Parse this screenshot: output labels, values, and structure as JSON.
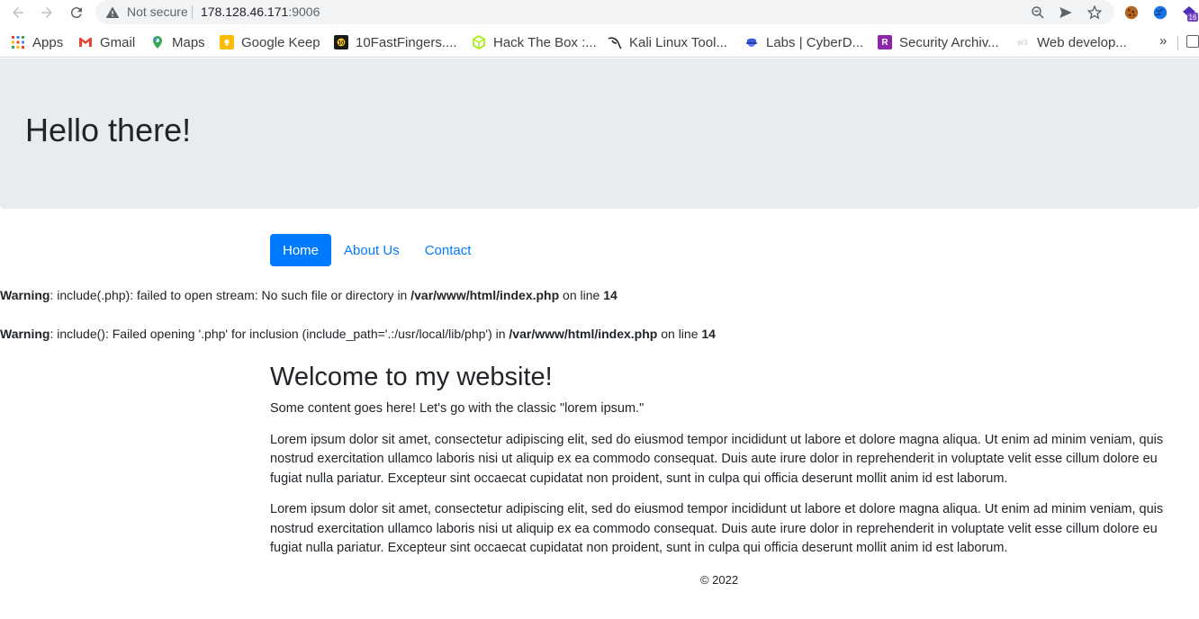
{
  "browser": {
    "not_secure": "Not secure",
    "url_host": "178.128.46.171",
    "url_port": ":9006"
  },
  "bookmarks": [
    {
      "label": "Apps",
      "icon": "apps-grid-icon"
    },
    {
      "label": "Gmail",
      "icon": "gmail-icon"
    },
    {
      "label": "Maps",
      "icon": "maps-icon"
    },
    {
      "label": "Google Keep",
      "icon": "keep-icon"
    },
    {
      "label": "10FastFingers....",
      "icon": "10fastfingers-icon"
    },
    {
      "label": "Hack The Box :...",
      "icon": "hackthebox-icon"
    },
    {
      "label": "Kali Linux Tool...",
      "icon": "kali-icon"
    },
    {
      "label": "Labs | CyberD...",
      "icon": "cyberdefenders-icon"
    },
    {
      "label": "Security Archiv...",
      "icon": "security-archive-icon"
    },
    {
      "label": "Web develop...",
      "icon": "w3schools-icon"
    }
  ],
  "bookmarks_more": "»",
  "page": {
    "jumbotron_title": "Hello there!",
    "nav": [
      "Home",
      "About Us",
      "Contact"
    ],
    "warnings": [
      {
        "label": "Warning",
        "text": ": include(.php): failed to open stream: No such file or directory in ",
        "path": "/var/www/html/index.php",
        "mid": " on line ",
        "line": "14"
      },
      {
        "label": "Warning",
        "text": ": include(): Failed opening '.php' for inclusion (include_path='.:/usr/local/lib/php') in ",
        "path": "/var/www/html/index.php",
        "mid": " on line ",
        "line": "14"
      }
    ],
    "heading": "Welcome to my website!",
    "intro": "Some content goes here! Let's go with the classic \"lorem ipsum.\"",
    "paragraphs": [
      "Lorem ipsum dolor sit amet, consectetur adipiscing elit, sed do eiusmod tempor incididunt ut labore et dolore magna aliqua. Ut enim ad minim veniam, quis nostrud exercitation ullamco laboris nisi ut aliquip ex ea commodo consequat. Duis aute irure dolor in reprehenderit in voluptate velit esse cillum dolore eu fugiat nulla pariatur. Excepteur sint occaecat cupidatat non proident, sunt in culpa qui officia deserunt mollit anim id est laborum.",
      "Lorem ipsum dolor sit amet, consectetur adipiscing elit, sed do eiusmod tempor incididunt ut labore et dolore magna aliqua. Ut enim ad minim veniam, quis nostrud exercitation ullamco laboris nisi ut aliquip ex ea commodo consequat. Duis aute irure dolor in reprehenderit in voluptate velit esse cillum dolore eu fugiat nulla pariatur. Excepteur sint occaecat cupidatat non proident, sunt in culpa qui officia deserunt mollit anim id est laborum."
    ],
    "footer": "© 2022"
  },
  "colors": {
    "primary": "#007bff",
    "jumbotron_bg": "#e9ecef",
    "text": "#212529"
  }
}
